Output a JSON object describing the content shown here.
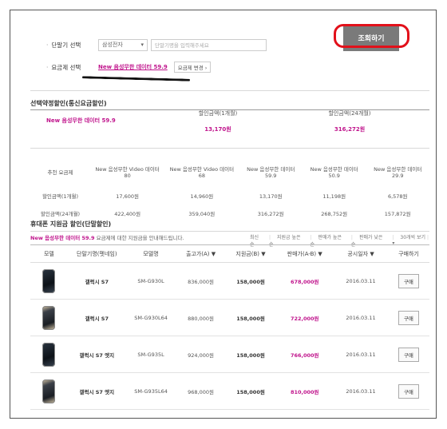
{
  "filters": {
    "device_label": "단말기 선택",
    "manufacturer": "삼성전자",
    "search_placeholder": "단말기명을 입력해주세요",
    "plan_label": "요금제 선택",
    "plan_name": "New 음성무한 데이터 59.9",
    "plan_change": "요금제 변경",
    "search_button": "조회하기"
  },
  "contract_section": {
    "title": "선택약정할인(통신요금할인)",
    "plan_name": "New 음성무한 데이터 59.9",
    "col1_label": "할인금액(1개월)",
    "col1_value": "13,170원",
    "col2_label": "할인금액(24개월)",
    "col2_value": "316,272원"
  },
  "compare_table": {
    "header_label": "추천 요금제",
    "plans": [
      "New 음성무한 Video 데이터 80",
      "New 음성무한 Video 데이터 68",
      "New 음성무한 데이터 59.9",
      "New 음성무한 데이터 50.9",
      "New 음성무한 데이터 29.9"
    ],
    "row1_label": "할인금액(1개월)",
    "row1": [
      "17,600원",
      "14,960원",
      "13,170원",
      "11,198원",
      "6,578원"
    ],
    "row2_label": "할인금액(24개월)",
    "row2": [
      "422,400원",
      "359,040원",
      "316,272원",
      "268,752원",
      "157,872원"
    ]
  },
  "phone_section": {
    "title": "휴대폰 지원금 할인(단말할인)",
    "desc_plan": "New 음성무한 데이터 59.9",
    "desc_text": " 요금제에 대한 지원금을 안내해드립니다.",
    "sort": [
      "최신순",
      "지원금 높은순",
      "판매가 높은순",
      "판매가 낮은순",
      "30개씩 보기"
    ],
    "headers": [
      "모델",
      "단말기명(펫네임)",
      "모델명",
      "출고가(A) ▼",
      "지원금(B) ▼",
      "판매가(A-B) ▼",
      "공시일자 ▼",
      "구매하기"
    ],
    "rows": [
      {
        "pet": "갤럭시 S7",
        "model": "SM-G930L",
        "release": "836,000원",
        "support": "158,000원",
        "sale": "678,000원",
        "date": "2016.03.11",
        "buy": "구매",
        "color": "dark"
      },
      {
        "pet": "갤럭시 S7",
        "model": "SM-G930L64",
        "release": "880,000원",
        "support": "158,000원",
        "sale": "722,000원",
        "date": "2016.03.11",
        "buy": "구매",
        "color": "gold"
      },
      {
        "pet": "갤럭시 S7 엣지",
        "model": "SM-G935L",
        "release": "924,000원",
        "support": "158,000원",
        "sale": "766,000원",
        "date": "2016.03.11",
        "buy": "구매",
        "color": "dark"
      },
      {
        "pet": "갤럭시 S7 엣지",
        "model": "SM-G935L64",
        "release": "968,000원",
        "support": "158,000원",
        "sale": "810,000원",
        "date": "2016.03.11",
        "buy": "구매",
        "color": "gold"
      }
    ]
  },
  "colors": {
    "accent": "#c0148c",
    "button": "#7a7a7a",
    "annotation": "#e2101a"
  }
}
